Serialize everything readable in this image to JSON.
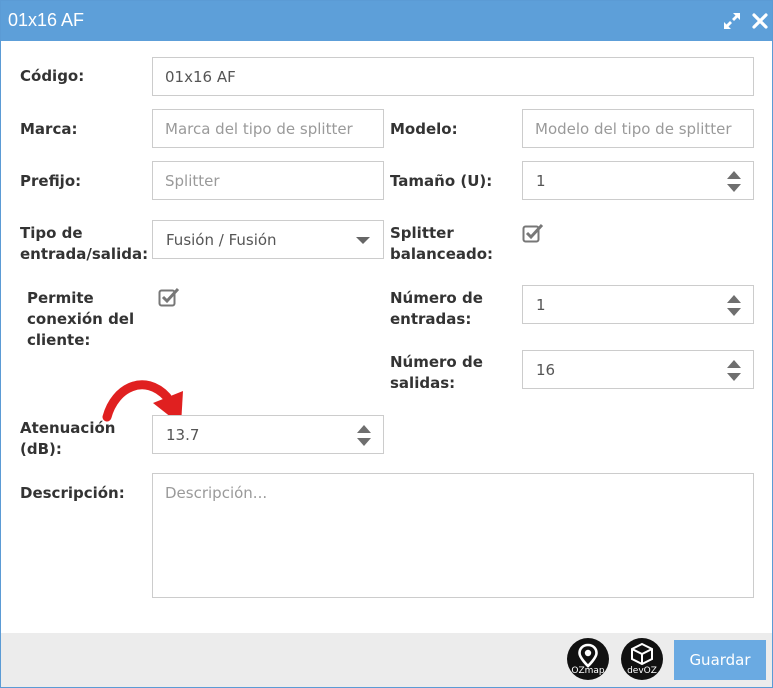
{
  "window": {
    "title": "01x16 AF",
    "title_color": "#5d9fd9",
    "icons": [
      "expand-icon",
      "close-icon"
    ]
  },
  "form": {
    "codigo": {
      "label": "Código:",
      "value": "01x16 AF"
    },
    "marca": {
      "label": "Marca:",
      "value": "",
      "placeholder": "Marca del tipo de splitter"
    },
    "modelo": {
      "label": "Modelo:",
      "value": "",
      "placeholder": "Modelo del tipo de splitter"
    },
    "prefijo": {
      "label": "Prefijo:",
      "value": "",
      "placeholder": "Splitter"
    },
    "tamano": {
      "label": "Tamaño (U):",
      "value": "1"
    },
    "tipo": {
      "label_line1": "Tipo de",
      "label_line2": "entrada/salida:",
      "selected": "Fusión / Fusión"
    },
    "balanceado": {
      "label_line1": "Splitter",
      "label_line2": "balanceado:",
      "checked": true
    },
    "permite": {
      "label_line1": "Permite",
      "label_line2": "conexión del",
      "label_line3": "cliente:",
      "checked": true
    },
    "entradas": {
      "label_line1": "Número de",
      "label_line2": "entradas:",
      "value": "1"
    },
    "salidas": {
      "label_line1": "Número de",
      "label_line2": "salidas:",
      "value": "16"
    },
    "atenuacion": {
      "label_line1": "Atenuación",
      "label_line2": "(dB):",
      "value": "13.7"
    },
    "descripcion": {
      "label": "Descripción:",
      "placeholder": "Descripción..."
    }
  },
  "footer": {
    "ozmap_text": "OZmap",
    "devoz_text": "devOZ",
    "save_label": "Guardar",
    "save_color": "#6aaae2"
  },
  "annotation": {
    "arrow_color": "#e02020"
  }
}
